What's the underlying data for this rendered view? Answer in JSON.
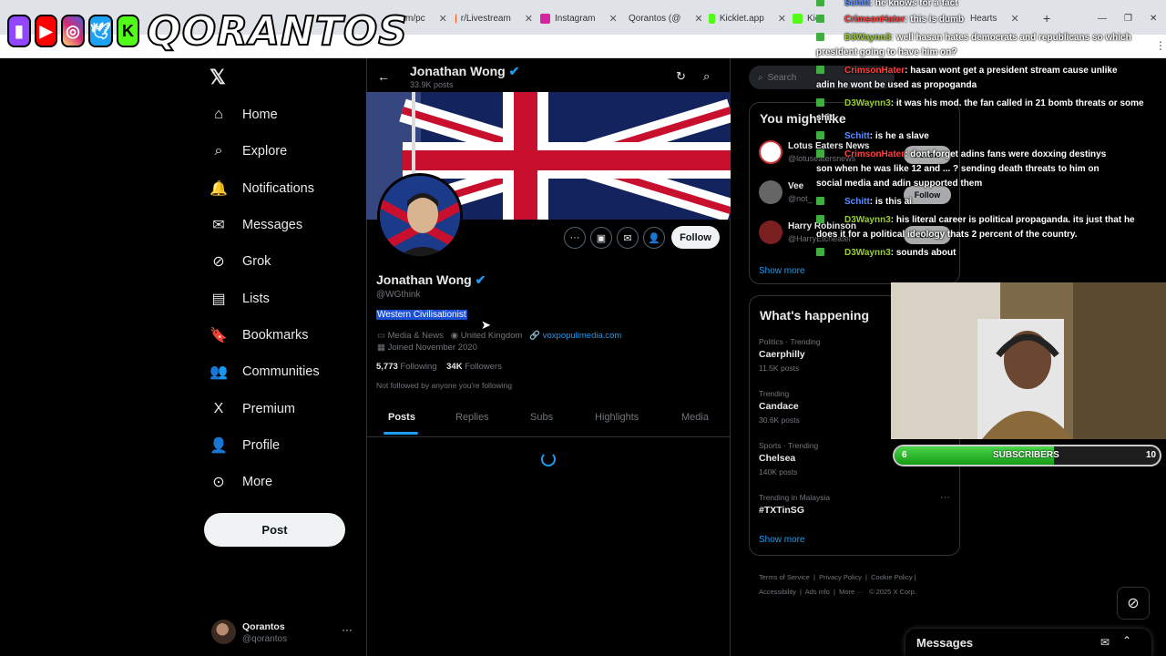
{
  "browser": {
    "tabs": [
      {
        "label": "m/pc",
        "color": "#888888"
      },
      {
        "label": "r/Livestream",
        "color": "#ff4500"
      },
      {
        "label": "Instagram",
        "color": "#d6249f"
      },
      {
        "label": "Qorantos (@",
        "color": "#000000"
      },
      {
        "label": "Kicklet.app",
        "color": "#53fc18"
      },
      {
        "label": "Kic",
        "color": "#53fc18"
      },
      {
        "label": "Hearts",
        "color": "#cc3366"
      }
    ]
  },
  "overlay": {
    "logo_text": "QORANTOS"
  },
  "nav": {
    "items": [
      {
        "label": "Home",
        "icon": "⌂"
      },
      {
        "label": "Explore",
        "icon": "⌕"
      },
      {
        "label": "Notifications",
        "icon": "🔔"
      },
      {
        "label": "Messages",
        "icon": "✉"
      },
      {
        "label": "Grok",
        "icon": "⊘"
      },
      {
        "label": "Lists",
        "icon": "▤"
      },
      {
        "label": "Bookmarks",
        "icon": "🔖"
      },
      {
        "label": "Communities",
        "icon": "👥"
      },
      {
        "label": "Premium",
        "icon": "X"
      },
      {
        "label": "Profile",
        "icon": "👤"
      },
      {
        "label": "More",
        "icon": "⊙"
      }
    ],
    "post_label": "Post",
    "me_name": "Qorantos",
    "me_handle": "@qorantos"
  },
  "profile": {
    "header_name": "Jonathan Wong",
    "header_posts": "33.9K posts",
    "name": "Jonathan Wong",
    "handle": "@WGthink",
    "bio": "Western Civilisationist",
    "category": "Media & News",
    "location": "United Kingdom",
    "website": "voxpopulimedia.com",
    "joined": "Joined November 2020",
    "following_count": "5,773",
    "following_label": "Following",
    "followers_count": "34K",
    "followers_label": "Followers",
    "not_followed": "Not followed by anyone you're following",
    "follow_label": "Follow",
    "tabs": [
      "Posts",
      "Replies",
      "Subs",
      "Highlights",
      "Media"
    ]
  },
  "right": {
    "search_placeholder": "Search",
    "you_might_like": "You might like",
    "suggestions": [
      {
        "name": "Lotus Eaters News",
        "handle": "@lotuseatersnews",
        "btn": "Follow"
      },
      {
        "name": "Vee",
        "handle": "@not_",
        "btn": "Follow"
      },
      {
        "name": "Harry Robinson",
        "handle": "@HarryEtcheater",
        "btn": "Follow"
      }
    ],
    "show_more": "Show more",
    "whats_happening": "What's happening",
    "trends": [
      {
        "cat": "Politics · Trending",
        "name": "Caerphilly",
        "count": "11.5K posts"
      },
      {
        "cat": "Trending",
        "name": "Candace",
        "count": "30.6K posts"
      },
      {
        "cat": "Sports · Trending",
        "name": "Chelsea",
        "count": "140K posts"
      },
      {
        "cat": "Trending in Malaysia",
        "name": "#TXTinSG",
        "count": ""
      }
    ],
    "show_more_2": "Show more",
    "footer": [
      "Terms of Service",
      "Privacy Policy",
      "Cookie Policy",
      "Accessibility",
      "Ads info",
      "More ···",
      "© 2025 X Corp."
    ],
    "messages": "Messages"
  },
  "chat": [
    {
      "user": "Schitt",
      "color": "#5b8cff",
      "msg": ": he knows for a fact"
    },
    {
      "user": "CrimsonHater",
      "color": "#ff4040",
      "msg": ": this is dumb"
    },
    {
      "user": "D3Waynn3",
      "color": "#9acd32",
      "msg": ": well hasan hates democrats and republicans so which"
    },
    {
      "user": "",
      "color": "#ffffff",
      "msg": "president going to have him on?"
    },
    {
      "user": "CrimsonHater",
      "color": "#ff4040",
      "msg": ": hasan wont get a president stream cause unlike"
    },
    {
      "user": "",
      "color": "#ffffff",
      "msg": "adin he wont be used as propoganda"
    },
    {
      "user": "D3Waynn3",
      "color": "#9acd32",
      "msg": ": it was his mod. the fan called in 21 bomb threats or some"
    },
    {
      "user": "",
      "color": "#ffffff",
      "msg": "shit"
    },
    {
      "user": "Schitt",
      "color": "#5b8cff",
      "msg": ": is he a slave"
    },
    {
      "user": "CrimsonHater",
      "color": "#ff4040",
      "msg": ": dont forget adins fans were doxxing destinys"
    },
    {
      "user": "",
      "color": "#ffffff",
      "msg": "son when he was like 12 and ... ?   sending death threats to him on"
    },
    {
      "user": "",
      "color": "#ffffff",
      "msg": "social media and adin supported them"
    },
    {
      "user": "Schitt",
      "color": "#5b8cff",
      "msg": ": is this ai"
    },
    {
      "user": "D3Waynn3",
      "color": "#9acd32",
      "msg": ": his literal career is political propaganda. its just that he"
    },
    {
      "user": "",
      "color": "#ffffff",
      "msg": "does it for a political ideology thats 2 percent of the country."
    },
    {
      "user": "D3Waynn3",
      "color": "#9acd32",
      "msg": ": sounds about"
    }
  ],
  "subgoal": {
    "current": "6",
    "label": "SUBSCRIBERS",
    "target": "10",
    "progress": 0.6
  }
}
